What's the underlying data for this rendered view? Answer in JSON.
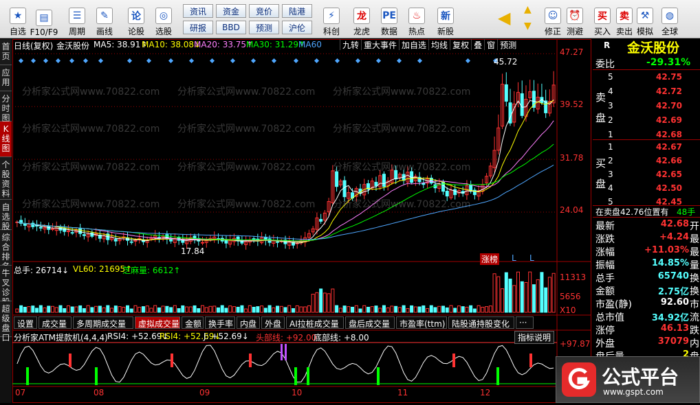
{
  "toolbar": {
    "items": [
      {
        "label": "自选",
        "icon": "star-icon"
      },
      {
        "label": "F10/F9",
        "icon": "f10-icon"
      },
      {
        "label": "周期",
        "icon": "cycle-icon"
      },
      {
        "label": "画线",
        "icon": "pencil-icon"
      },
      {
        "label": "论股",
        "icon": "discussion-icon"
      },
      {
        "label": "选股",
        "icon": "filter-icon"
      },
      {
        "label": "科创",
        "icon": "kechuang-icon"
      },
      {
        "label": "龙虎",
        "icon": "longhu-icon"
      },
      {
        "label": "数据",
        "icon": "pe-data-icon"
      },
      {
        "label": "热点",
        "icon": "hot-icon"
      },
      {
        "label": "新股",
        "icon": "ipo-icon"
      },
      {
        "label": "修正",
        "icon": "smile-icon"
      },
      {
        "label": "测避",
        "icon": "alarm-icon"
      },
      {
        "label": "买入",
        "icon": "buy-icon"
      },
      {
        "label": "卖出",
        "icon": "sell-icon"
      },
      {
        "label": "模拟",
        "icon": "hammer-icon"
      },
      {
        "label": "全球",
        "icon": "globe-icon"
      }
    ],
    "mid_buttons": [
      "资讯",
      "资金",
      "竞价",
      "陆港",
      "研报",
      "BBD",
      "预测",
      "沪伦"
    ]
  },
  "sidebar": {
    "items": [
      "首页",
      "应用",
      "分时图",
      "K线图",
      "个股资料",
      "自选股",
      "综合排名",
      "牛叉诊股",
      "超级盘口"
    ]
  },
  "kline": {
    "header": {
      "title": "日线(复权)",
      "name": "金沃股份",
      "ma5": "MA5: 38.91↑",
      "ma10": "MA10: 38.08↓",
      "ma20": "MA20: 33.75↑",
      "ma30": "MA30: 31.29↑",
      "ma60": "MA60"
    },
    "top_buttons": [
      "九转",
      "重大事件",
      "加自选",
      "均线",
      "复权",
      "叠",
      "窗",
      "预测"
    ],
    "y_ticks": [
      "47.27",
      "39.52",
      "31.78",
      "24.04"
    ],
    "high_label": "45.72",
    "low_label": "17.84",
    "watermark": "分析家公式网www.70822.com",
    "tag_zb": "涨榜",
    "tag_l": "L"
  },
  "volume": {
    "title": "总手: 26714↓",
    "vl60": "VL60: 21695↑",
    "zhima": "芝麻量: 6612↑",
    "y_ticks": [
      "11313",
      "5656",
      "X10"
    ]
  },
  "tabs": [
    "设置",
    "成交量",
    "多周期成交量",
    "虚拟成交量",
    "金额",
    "换手率",
    "内盘",
    "外盘",
    "AI拉桩成交量",
    "盘后成交量",
    "市盈率(ttm)",
    "陆股通持股变化",
    "···"
  ],
  "active_tab": "虚拟成交量",
  "indicator": {
    "name": "分析家ATM提款机(4,4,4)",
    "rsi4a": "RSI4: +52.69↓",
    "rsi4b": "RSI4: +52.69↓",
    "j": "J: +52.69↓",
    "top": "头部线: +92.00",
    "bottom": "底部线: +8.00",
    "explain": "指标说明",
    "y_top": "+97.87",
    "buy": "买",
    "sell": "卖"
  },
  "x_axis": [
    "07",
    "08",
    "09",
    "10",
    "11",
    "12"
  ],
  "quote": {
    "code_label": "R",
    "name": "金沃股份",
    "weibi_label": "委比",
    "weibi": "-29.31%",
    "sell_label": "卖盘",
    "buy_label": "买盘",
    "sell": [
      {
        "n": "5",
        "p": "42.75"
      },
      {
        "n": "4",
        "p": "42.72"
      },
      {
        "n": "3",
        "p": "42.70"
      },
      {
        "n": "2",
        "p": "42.69"
      },
      {
        "n": "1",
        "p": "42.68"
      }
    ],
    "buy": [
      {
        "n": "1",
        "p": "42.67"
      },
      {
        "n": "2",
        "p": "42.66"
      },
      {
        "n": "3",
        "p": "42.65"
      },
      {
        "n": "4",
        "p": "42.50"
      },
      {
        "n": "5",
        "p": "42.45"
      }
    ],
    "trade_note": "在卖盘42.76位置有",
    "trade_qty": "48手",
    "stats": [
      {
        "l": "最新",
        "v": "42.68",
        "s": "开"
      },
      {
        "l": "涨跌",
        "v": "+4.24",
        "s": "最"
      },
      {
        "l": "涨幅",
        "v": "+11.03%",
        "s": "最"
      },
      {
        "l": "振幅",
        "v": "14.85%",
        "s": "量"
      },
      {
        "l": "总手",
        "v": "65740",
        "s": "换"
      },
      {
        "l": "金额",
        "v": "2.75亿",
        "s": "换"
      },
      {
        "l": "市盈(静)",
        "v": "92.60",
        "s": "市"
      },
      {
        "l": "总市值",
        "v": "34.92亿",
        "s": "流"
      },
      {
        "l": "涨停",
        "v": "46.13",
        "s": "跌"
      },
      {
        "l": "外盘",
        "v": "37079",
        "s": "内"
      },
      {
        "l": "盘后量",
        "v": "2",
        "s": "盘"
      }
    ]
  },
  "logo": {
    "text": "公式平台",
    "url": "www.gspt.com"
  },
  "colors": {
    "up": "#ff3232",
    "down": "#54ffff",
    "ma5": "#ffffff",
    "ma10": "#ffff00",
    "ma20": "#ff80ff",
    "ma30": "#00ff00",
    "ma60": "#4fa7ff",
    "grid": "#a00000"
  },
  "chart_data": {
    "type": "candlestick",
    "x_ticks": [
      "07",
      "08",
      "09",
      "10",
      "11",
      "12"
    ],
    "price_range": [
      17.84,
      47.27
    ],
    "close": [
      22.6,
      22.4,
      22.1,
      22.3,
      21.9,
      22.0,
      21.7,
      21.8,
      21.5,
      21.6,
      21.9,
      21.4,
      21.2,
      21.3,
      21.0,
      21.4,
      20.9,
      20.6,
      20.8,
      20.5,
      20.9,
      20.2,
      20.6,
      20.0,
      20.3,
      19.8,
      20.1,
      20.4,
      19.9,
      19.6,
      19.9,
      20.2,
      19.7,
      19.9,
      20.3,
      20.6,
      20.2,
      20.5,
      20.1,
      19.8,
      20.2,
      19.9,
      19.6,
      19.9,
      20.3,
      20.1,
      19.8,
      19.6,
      19.9,
      20.2,
      20.4,
      20.1,
      19.8,
      19.5,
      19.9,
      20.2,
      19.8,
      19.5,
      19.7,
      19.9,
      20.1,
      19.8,
      20.3,
      19.9,
      19.6,
      19.9,
      19.6,
      19.8,
      19.4,
      19.7,
      19.2,
      19.5,
      19.9,
      20.3,
      20.9,
      21.6,
      23.2,
      22.7,
      23.9,
      25.6,
      30.1,
      27.8,
      28.6,
      26.3,
      26.9,
      26.1,
      27.5,
      26.8,
      28.1,
      27.4,
      28.6,
      27.9,
      29.4,
      27.8,
      28.6,
      30.2,
      28.9,
      29.6,
      28.7,
      29.9,
      28.4,
      29.3,
      28.5,
      28.1,
      28.9,
      28.3,
      27.6,
      28.2,
      27.1,
      26.4,
      27.3,
      26.6,
      27.2,
      26.8,
      27.9,
      27.1,
      26.6,
      27.2,
      28.1,
      29.3,
      30.8,
      33.1,
      36.4,
      42.8,
      40.3,
      37.1,
      39.9,
      41.6,
      38.2,
      40.6,
      41.7,
      39.4,
      40.9,
      40.1,
      38.6,
      40.3,
      42.68
    ],
    "volume_scale": [
      0,
      11313
    ]
  }
}
